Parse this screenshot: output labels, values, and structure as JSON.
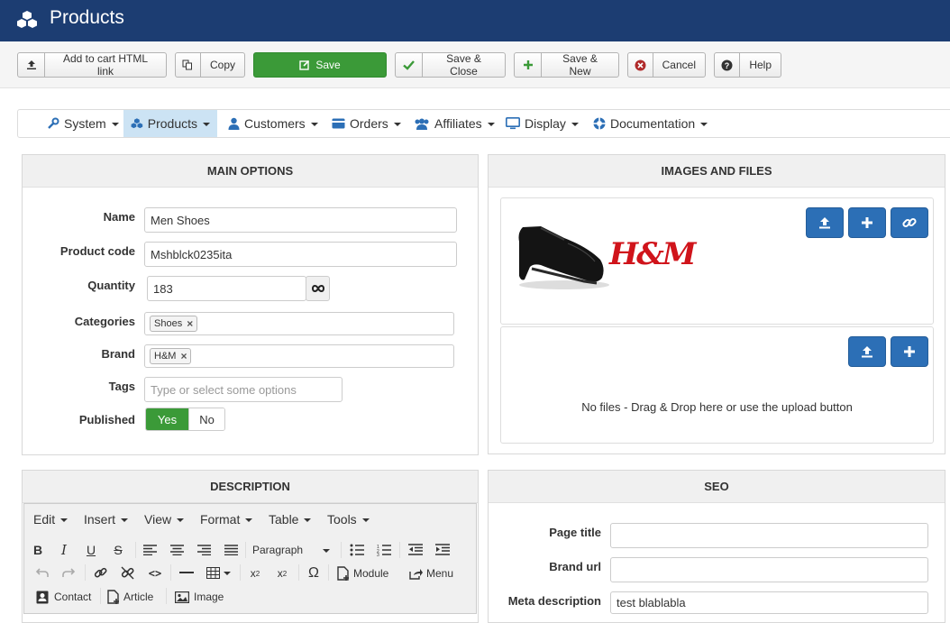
{
  "header": {
    "title": "Products",
    "logo_icon": "cubes-icon"
  },
  "toolbar": {
    "add_cart": "Add to cart HTML link",
    "copy": "Copy",
    "save": "Save",
    "save_close": "Save & Close",
    "save_new": "Save & New",
    "cancel": "Cancel",
    "help": "Help"
  },
  "menu": {
    "system": "System",
    "products": "Products",
    "customers": "Customers",
    "orders": "Orders",
    "affiliates": "Affiliates",
    "display": "Display",
    "documentation": "Documentation"
  },
  "main_options": {
    "title": "MAIN OPTIONS",
    "name_label": "Name",
    "name_value": "Men Shoes",
    "code_label": "Product code",
    "code_value": "Mshblck0235ita",
    "qty_label": "Quantity",
    "qty_value": "183",
    "cat_label": "Categories",
    "cat_tag": "Shoes",
    "brand_label": "Brand",
    "brand_tag": "H&M",
    "tags_label": "Tags",
    "tags_placeholder": "Type or select some options",
    "pub_label": "Published",
    "pub_yes": "Yes",
    "pub_no": "No"
  },
  "images": {
    "title": "IMAGES AND FILES",
    "brand_logo_text": "H&M",
    "no_files": "No files - Drag & Drop here or use the upload button"
  },
  "description": {
    "title": "DESCRIPTION",
    "menus": [
      "Edit",
      "Insert",
      "View",
      "Format",
      "Table",
      "Tools"
    ],
    "paragraph": "Paragraph",
    "module": "Module",
    "menu": "Menu",
    "contact": "Contact",
    "article": "Article",
    "image": "Image"
  },
  "seo": {
    "title": "SEO",
    "page_title_label": "Page title",
    "brand_url_label": "Brand url",
    "meta_desc_label": "Meta description",
    "meta_desc_value": "test blablabla"
  },
  "colors": {
    "header": "#1c3d72",
    "save_green": "#3b9a38",
    "blue_button": "#2c6fb6"
  }
}
